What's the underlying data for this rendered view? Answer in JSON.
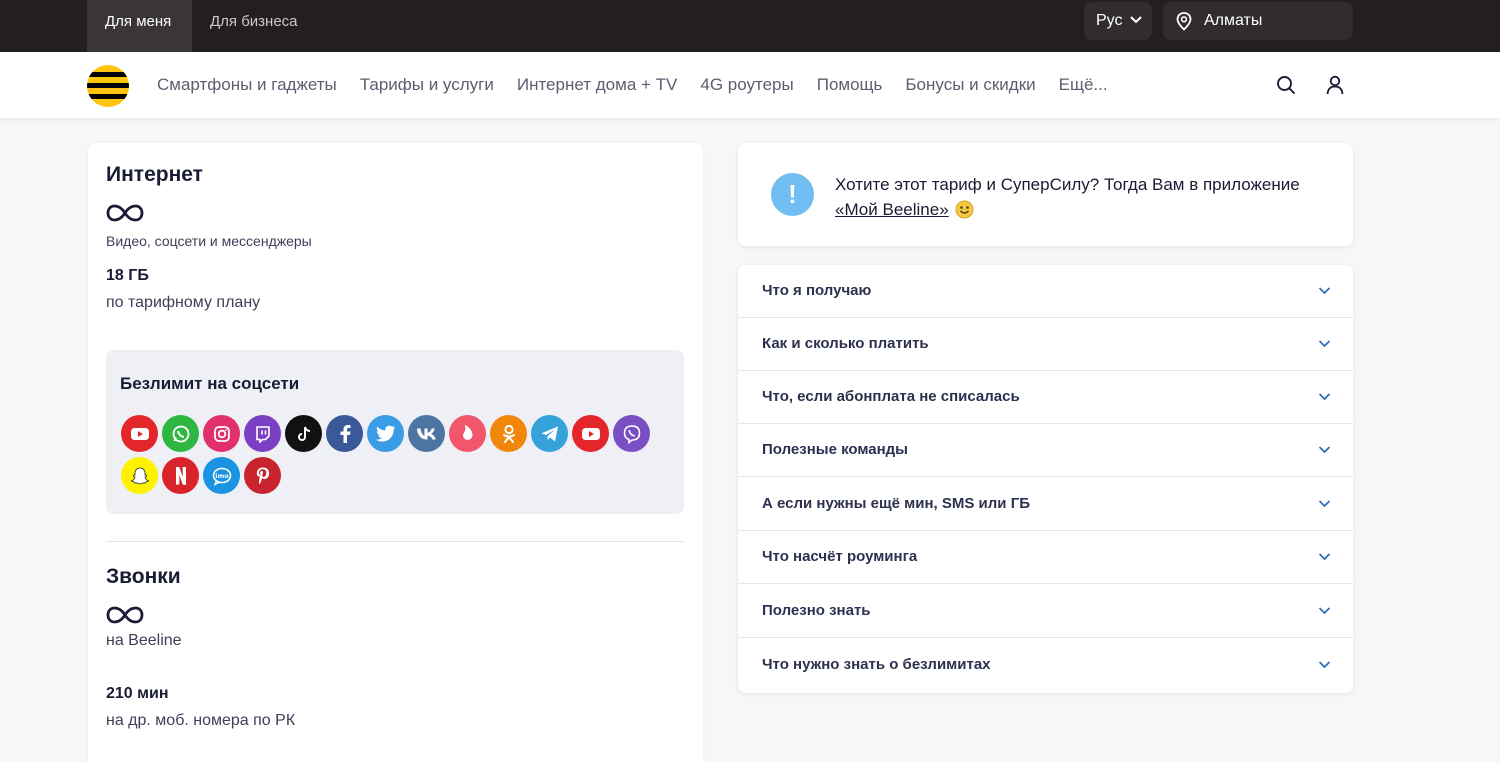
{
  "topbar": {
    "segments": [
      {
        "label": "Для меня",
        "active": true
      },
      {
        "label": "Для бизнеса",
        "active": false
      }
    ],
    "language": "Рус",
    "city": "Алматы"
  },
  "nav": {
    "items": [
      "Смартфоны и гаджеты",
      "Тарифы и услуги",
      "Интернет дома + TV",
      "4G роутеры",
      "Помощь",
      "Бонусы и скидки",
      "Ещё..."
    ]
  },
  "internet": {
    "title": "Интернет",
    "unlimited_caption": "Видео, соцсети и мессенджеры",
    "amount": "18 ГБ",
    "amount_caption": "по тарифному плану",
    "social": {
      "title": "Безлимит на соцсети",
      "icons": [
        {
          "name": "youtube-icon",
          "color": "#e3262a"
        },
        {
          "name": "whatsapp-icon",
          "color": "#2db742"
        },
        {
          "name": "instagram-icon",
          "color": "#e1306c"
        },
        {
          "name": "twitch-icon",
          "color": "#7b3fc4"
        },
        {
          "name": "tiktok-icon",
          "color": "#111111"
        },
        {
          "name": "facebook-icon",
          "color": "#3b5998"
        },
        {
          "name": "twitter-icon",
          "color": "#3a9be6"
        },
        {
          "name": "vk-icon",
          "color": "#4c75a3"
        },
        {
          "name": "tinder-icon",
          "color": "#f2566b"
        },
        {
          "name": "odnoklassniki-icon",
          "color": "#f0870b"
        },
        {
          "name": "telegram-icon",
          "color": "#35a2d9"
        },
        {
          "name": "youtube-icon",
          "color": "#e3262a"
        },
        {
          "name": "viber-icon",
          "color": "#7b4fc4"
        },
        {
          "name": "snapchat-icon",
          "color": "#fff200"
        },
        {
          "name": "netflix-icon",
          "color": "#d9232a"
        },
        {
          "name": "imo-icon",
          "color": "#1a94e0"
        },
        {
          "name": "pinterest-icon",
          "color": "#c9242e"
        }
      ]
    }
  },
  "calls": {
    "title": "Звонки",
    "unlimited_caption": "на Beeline",
    "amount": "210 мин",
    "amount_caption": "на др. моб. номера по РК"
  },
  "notice": {
    "text": "Хотите этот тариф и СуперСилу? Тогда Вам в приложение",
    "link": "«Мой Beeline»"
  },
  "accordion": {
    "items": [
      "Что я получаю",
      "Как и сколько платить",
      "Что, если абонплата не списалась",
      "Полезные команды",
      "А если нужны ещё мин, SMS или ГБ",
      "Что насчёт роуминга",
      "Полезно знать",
      "Что нужно знать о безлимитах"
    ]
  }
}
